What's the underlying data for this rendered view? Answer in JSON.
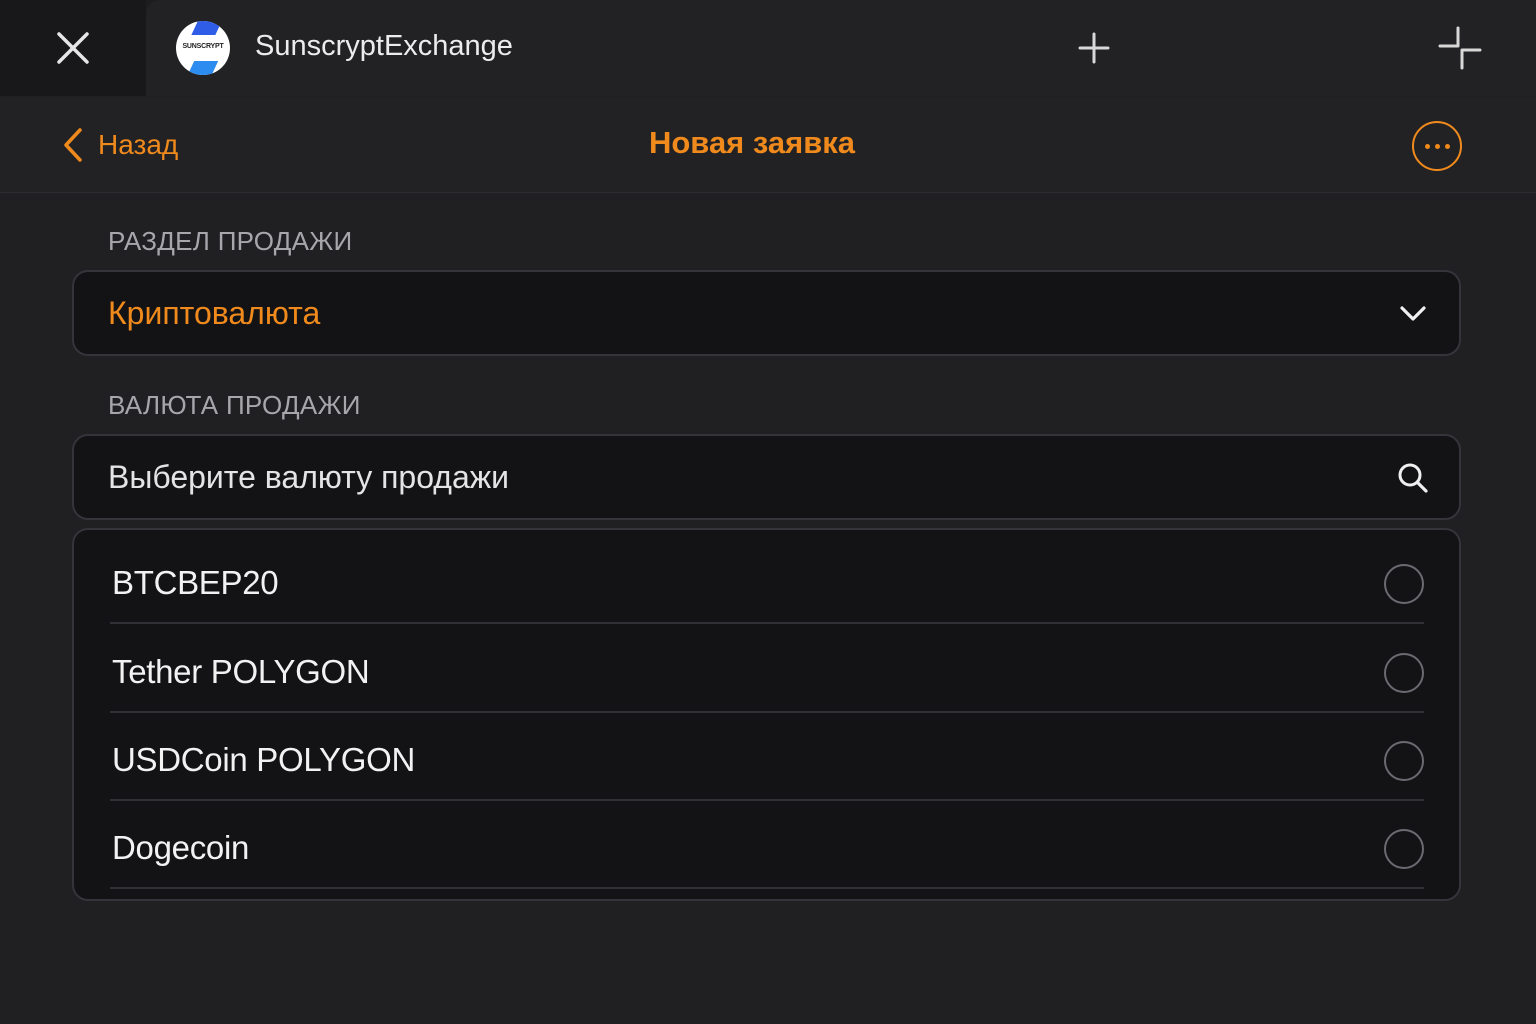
{
  "window": {
    "app_title": "SunscryptExchange",
    "logo_text": "SUNSCRYPT"
  },
  "nav": {
    "back_label": "Назад",
    "title": "Новая заявка"
  },
  "form": {
    "section_label": "РАЗДЕЛ ПРОДАЖИ",
    "section_value": "Криптовалюта",
    "currency_label": "ВАЛЮТА ПРОДАЖИ",
    "currency_placeholder": "Выберите валюту продажи"
  },
  "currencies": [
    {
      "label": "BTCBEP20",
      "selected": false
    },
    {
      "label": "Tether POLYGON",
      "selected": false
    },
    {
      "label": "USDCoin POLYGON",
      "selected": false
    },
    {
      "label": "Dogecoin",
      "selected": false
    }
  ],
  "colors": {
    "accent": "#f08a1c",
    "background": "#202023",
    "field_background": "#131316"
  },
  "icons": [
    "close-icon",
    "plus-icon",
    "fullscreen-icon",
    "chevron-left-icon",
    "more-icon",
    "chevron-down-icon",
    "search-icon",
    "radio-icon"
  ]
}
